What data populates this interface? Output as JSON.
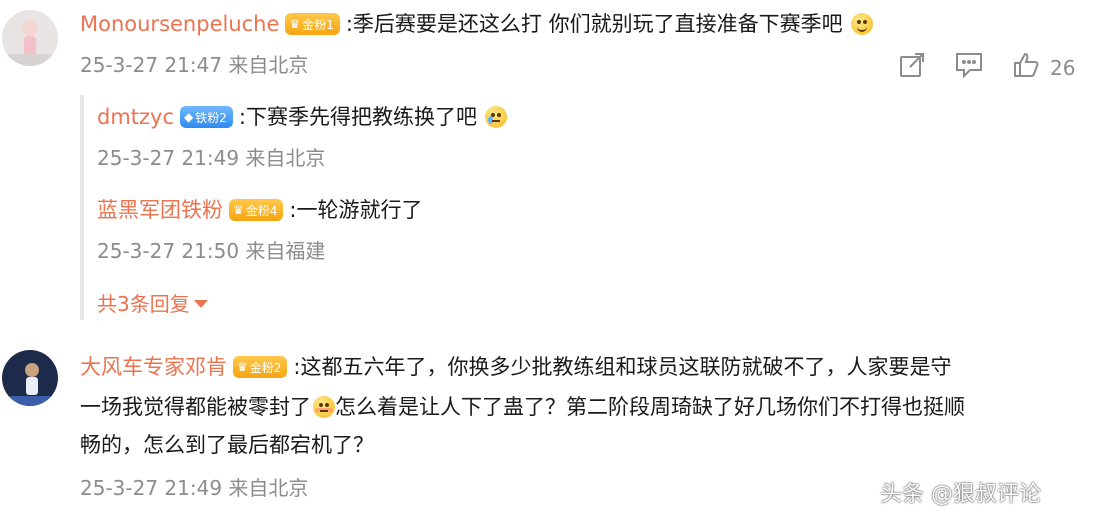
{
  "comments": [
    {
      "user": "Monoursenpeluche",
      "badge": "金粉1",
      "text": ":季后赛要是还这么打 你们就别玩了直接准备下赛季吧",
      "emoji": "smile-emoji",
      "time": "25-3-27 21:47 来自北京",
      "actions": {
        "share_icon": "share-icon",
        "comment_icon": "comment-icon",
        "like_icon": "like-icon",
        "like_count": "26"
      },
      "replies": [
        {
          "user": "dmtzyc",
          "badge": "铁粉2",
          "text": ":下赛季先得把教练换了吧",
          "emoji": "cry-emoji",
          "time": "25-3-27 21:49 来自北京"
        },
        {
          "user": "蓝黑军团铁粉",
          "badge": "金粉4",
          "text": ":一轮游就行了",
          "time": "25-3-27 21:50 来自福建"
        }
      ],
      "more_replies": "共3条回复"
    },
    {
      "user": "大风车专家邓肯",
      "badge": "金粉2",
      "text_line1": ":这都五六年了，你换多少批教练组和球员这联防就破不了，人家要是守",
      "text_line2a": "一场我觉得都能被零封了",
      "text_line2b": "怎么着是让人下了蛊了？第二阶段周琦缺了好几场你们不打得也挺顺",
      "text_line3": "畅的，怎么到了最后都宕机了？",
      "emoji": "shy-emoji",
      "time": "25-3-27 21:49 来自北京"
    }
  ],
  "watermark": "头条 @狠叔评论"
}
